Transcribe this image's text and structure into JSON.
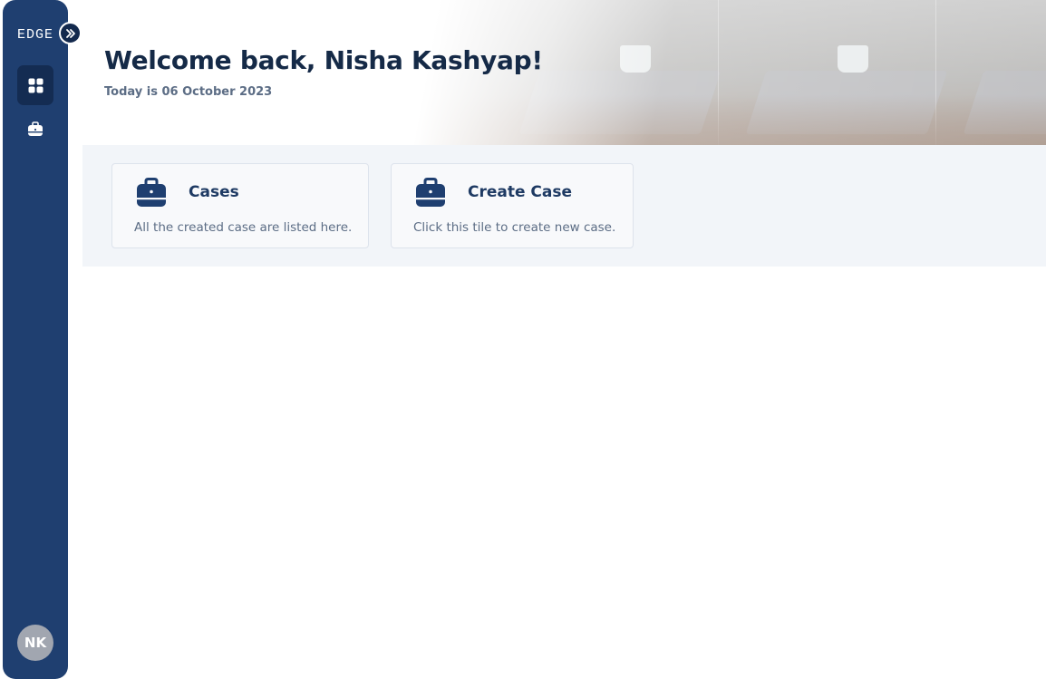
{
  "app": {
    "logo_text": "EDGE"
  },
  "sidebar": {
    "items": [
      {
        "label": "Dashboard",
        "icon": "dashboard-grid-icon",
        "active": true
      },
      {
        "label": "Cases",
        "icon": "briefcase-icon",
        "active": false
      }
    ],
    "expand_icon": "double-chevron-right-icon",
    "user_initials": "NK"
  },
  "header": {
    "welcome": "Welcome back, Nisha Kashyap!",
    "date_line": "Today is 06 October 2023"
  },
  "tiles": [
    {
      "title": "Cases",
      "description": "All the created case are listed here.",
      "icon": "briefcase-icon"
    },
    {
      "title": "Create Case",
      "description": "Click this tile to create new case.",
      "icon": "briefcase-icon"
    }
  ],
  "colors": {
    "sidebar_bg": "#1f3f70",
    "active_nav_bg": "#142c52",
    "heading": "#152a47",
    "tile_title": "#1e3a63",
    "muted_text": "#5c6d85",
    "tiles_area_bg": "#f2f5f9"
  }
}
